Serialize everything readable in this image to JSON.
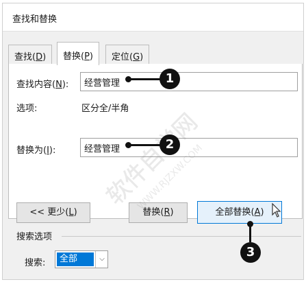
{
  "dialog": {
    "title": "查找和替换",
    "tabs": [
      {
        "prefix": "查找(",
        "key": "D",
        "suffix": ")"
      },
      {
        "prefix": "替换(",
        "key": "P",
        "suffix": ")"
      },
      {
        "prefix": "定位(",
        "key": "G",
        "suffix": ")"
      }
    ],
    "find": {
      "label_prefix": "查找内容(",
      "label_key": "N",
      "label_suffix": "):",
      "value": "经营管理"
    },
    "options": {
      "label": "选项:",
      "value": "区分全/半角"
    },
    "replace": {
      "label_prefix": "替换为(",
      "label_key": "I",
      "label_suffix": "):",
      "value": "经营管理"
    },
    "buttons": {
      "less": {
        "prefix": "<< 更少(",
        "key": "L",
        "suffix": ")"
      },
      "replace": {
        "prefix": "替换(",
        "key": "R",
        "suffix": ")"
      },
      "replace_all": {
        "prefix": "全部替换(",
        "key": "A",
        "suffix": ")"
      }
    },
    "search_options": {
      "group_label": "搜索选项",
      "search_label": "搜索:",
      "search_value": "全部"
    }
  },
  "callouts": [
    "1",
    "2",
    "3"
  ],
  "watermark": {
    "line1": "软件自学网",
    "line2": "WWW.RJZXW.COM"
  },
  "colors": {
    "accent": "#0078d7",
    "select_highlight": "#0078d7",
    "callout": "#111111"
  }
}
